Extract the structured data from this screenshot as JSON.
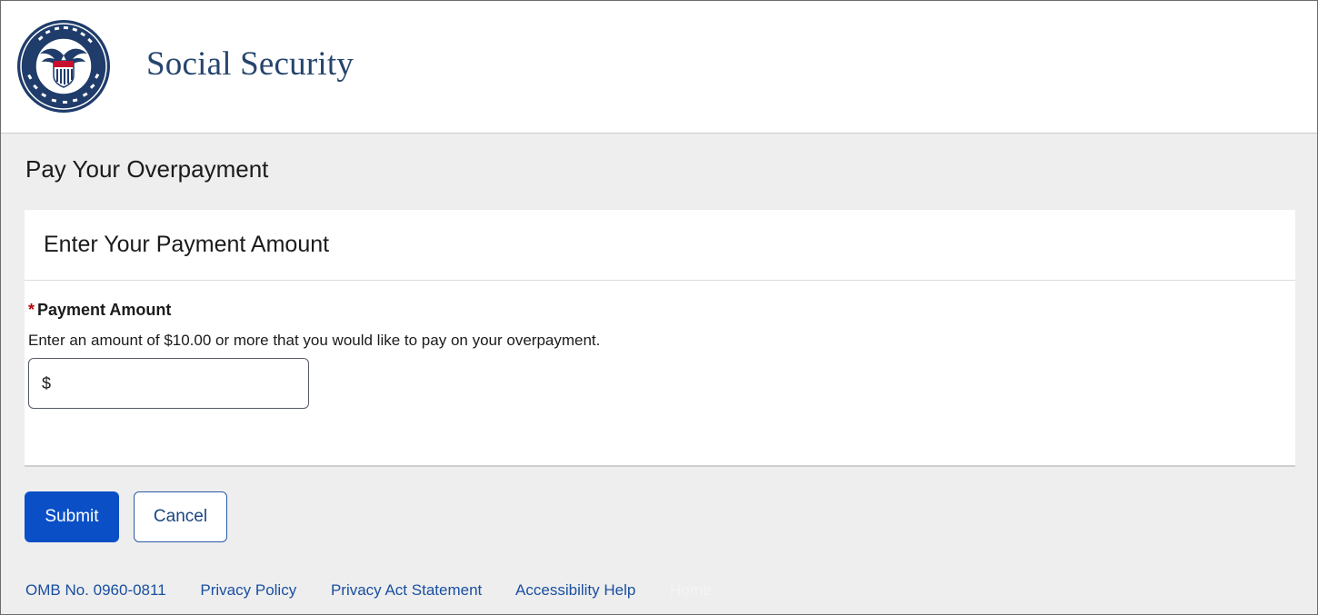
{
  "header": {
    "seal_alt": "Social Security Administration seal",
    "brand": "Social Security"
  },
  "page": {
    "title": "Pay Your Overpayment"
  },
  "card": {
    "title": "Enter Your Payment Amount",
    "field": {
      "required_mark": "*",
      "label": "Payment Amount",
      "hint": "Enter an amount of $10.00 or more that you would like to pay on your overpayment.",
      "currency": "$",
      "value": "",
      "placeholder": ""
    }
  },
  "actions": {
    "submit_label": "Submit",
    "cancel_label": "Cancel"
  },
  "footer": {
    "links": [
      "OMB No. 0960-0811",
      "Privacy Policy",
      "Privacy Act Statement",
      "Accessibility Help",
      "Home"
    ]
  },
  "colors": {
    "brand_navy": "#26456e",
    "primary_button": "#0b4fc7",
    "link": "#1a4fa0",
    "required": "#b50909",
    "page_background": "#eeeeee"
  }
}
